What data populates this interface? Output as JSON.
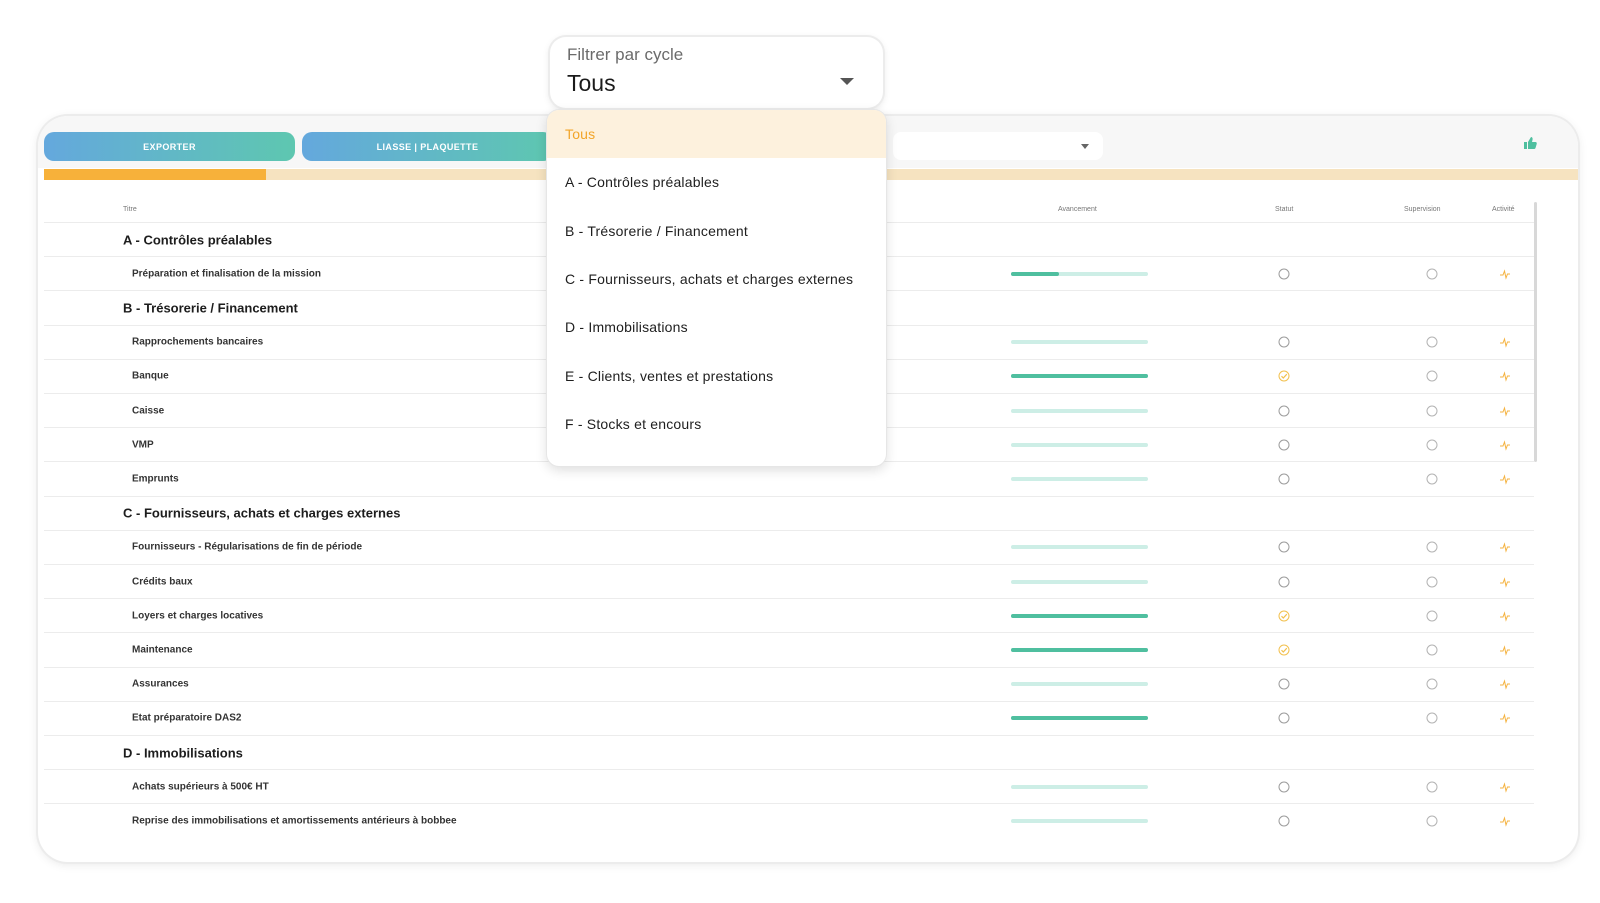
{
  "toolbar": {
    "export_label": "EXPORTER",
    "liasse_label": "LIASSE | PLAQUETTE"
  },
  "progress": {
    "fraction": 0.145,
    "fill_color": "#f7b13a",
    "track_color": "#f6e3c0"
  },
  "table": {
    "headers": {
      "title": "Titre",
      "progress": "Avancement",
      "status": "Statut",
      "supervision": "Supervision",
      "activity": "Activité"
    },
    "rows": [
      {
        "type": "section",
        "title": "A - Contrôles préalables"
      },
      {
        "type": "task",
        "title": "Préparation et finalisation de la mission",
        "progress": 0.35,
        "status": "empty"
      },
      {
        "type": "section",
        "title": "B - Trésorerie / Financement"
      },
      {
        "type": "task",
        "title": "Rapprochements bancaires",
        "progress": 0,
        "status": "empty"
      },
      {
        "type": "task",
        "title": "Banque",
        "progress": 1,
        "status": "done"
      },
      {
        "type": "task",
        "title": "Caisse",
        "progress": 0,
        "status": "empty"
      },
      {
        "type": "task",
        "title": "VMP",
        "progress": 0,
        "status": "empty"
      },
      {
        "type": "task",
        "title": "Emprunts",
        "progress": 0,
        "status": "empty"
      },
      {
        "type": "section",
        "title": "C - Fournisseurs, achats et charges externes"
      },
      {
        "type": "task",
        "title": "Fournisseurs - Régularisations de fin de période",
        "progress": 0,
        "status": "empty"
      },
      {
        "type": "task",
        "title": "Crédits baux",
        "progress": 0,
        "status": "empty"
      },
      {
        "type": "task",
        "title": "Loyers et charges locatives",
        "progress": 1,
        "status": "done"
      },
      {
        "type": "task",
        "title": "Maintenance",
        "progress": 1,
        "status": "done"
      },
      {
        "type": "task",
        "title": "Assurances",
        "progress": 0,
        "status": "empty"
      },
      {
        "type": "task",
        "title": "Etat préparatoire DAS2",
        "progress": 1,
        "status": "empty"
      },
      {
        "type": "section",
        "title": "D - Immobilisations"
      },
      {
        "type": "task",
        "title": "Achats supérieurs à 500€ HT",
        "progress": 0,
        "status": "empty"
      },
      {
        "type": "task",
        "title": "Reprise des immobilisations et amortissements antérieurs à bobbee",
        "progress": 0,
        "status": "empty"
      }
    ]
  },
  "filter": {
    "label": "Filtrer par cycle",
    "value": "Tous",
    "options": [
      "Tous",
      "A - Contrôles préalables",
      "B - Trésorerie / Financement",
      "C - Fournisseurs, achats et charges externes",
      "D - Immobilisations",
      "E - Clients, ventes et prestations",
      "F - Stocks et encours"
    ],
    "selected_index": 0
  },
  "colors": {
    "accent_orange": "#f2a529",
    "bar_fill": "#4fbf9f",
    "bar_track": "#cdeee6",
    "button_gradient_start": "#64a8dd",
    "button_gradient_end": "#5ec7b0"
  },
  "icons": {
    "status_empty": "empty-circle-icon",
    "status_done": "check-circle-icon",
    "activity": "activity-pulse-icon",
    "thumbs_up": "thumbs-up-icon"
  }
}
